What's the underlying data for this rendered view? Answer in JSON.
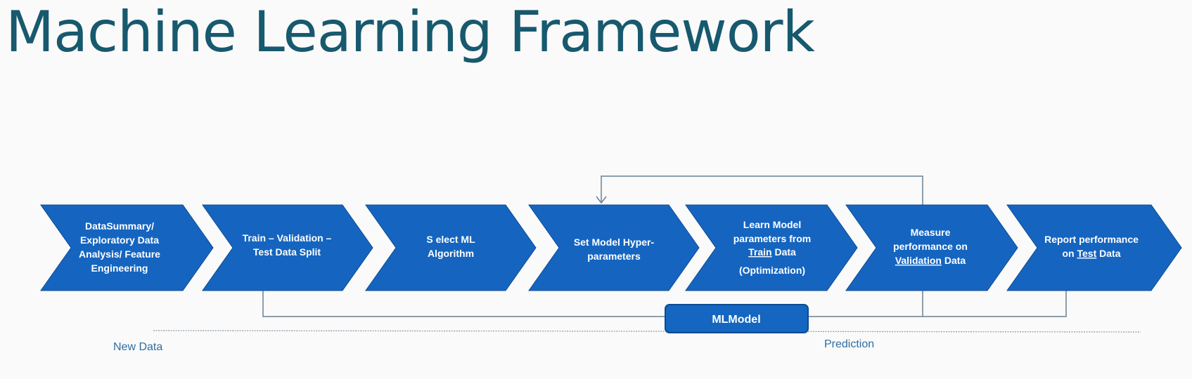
{
  "title": "Machine Learning Framework",
  "colors": {
    "title": "#17596e",
    "chevron_fill": "#1565c0",
    "chevron_stroke": "#0d4a94",
    "connector": "#6a7f92",
    "label": "#2e6da4",
    "model_fill": "#1466c0"
  },
  "steps": [
    {
      "lines": [
        [
          "DataSummary/"
        ],
        [
          "Exploratory Data"
        ],
        [
          "Analysis/ Feature"
        ],
        [
          "Engineering"
        ]
      ]
    },
    {
      "lines": [
        [
          "Train – Validation –"
        ],
        [
          "Test Data Split"
        ]
      ]
    },
    {
      "lines": [
        [
          "S elect ML"
        ],
        [
          "Algorithm"
        ]
      ]
    },
    {
      "lines": [
        [
          "Set Model Hyper-"
        ],
        [
          "parameters"
        ]
      ]
    },
    {
      "lines": [
        [
          "Learn Model"
        ],
        [
          "parameters from"
        ],
        [
          "Train",
          "u"
        ],
        [
          " Data"
        ],
        [
          "(Optimization)"
        ]
      ]
    },
    {
      "lines": [
        [
          "Measure"
        ],
        [
          "performance on"
        ],
        [
          "Validation",
          "u"
        ],
        [
          " Data"
        ]
      ]
    },
    {
      "lines": [
        [
          "Report performance"
        ],
        [
          "on "
        ],
        [
          "Test",
          "u"
        ],
        [
          " Data"
        ]
      ]
    }
  ],
  "model_label": "MLModel",
  "new_data_label": "New Data",
  "prediction_label": "Prediction"
}
